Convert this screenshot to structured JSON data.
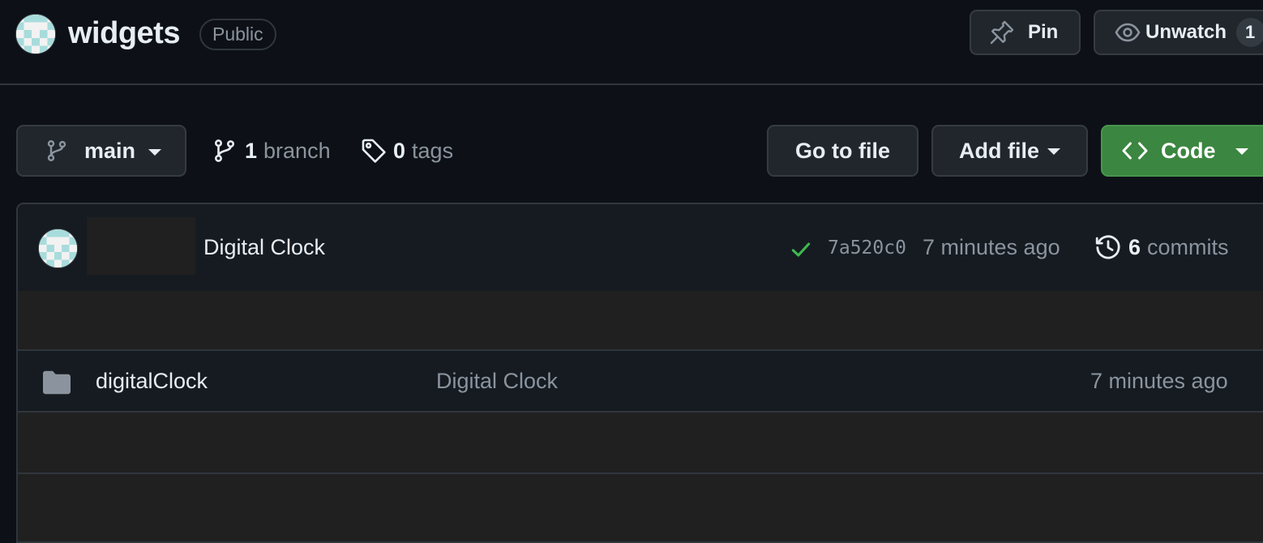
{
  "repo": {
    "name": "widgets",
    "visibility": "Public"
  },
  "header_actions": {
    "pin_label": "Pin",
    "watch_label": "Unwatch",
    "watch_count": "1"
  },
  "toolbar": {
    "branch": "main",
    "branch_count": "1",
    "branch_word": "branch",
    "tag_count": "0",
    "tag_word": "tags",
    "goto_file_label": "Go to file",
    "add_file_label": "Add file",
    "code_label": "Code"
  },
  "latest_commit": {
    "message": "Digital Clock",
    "status": "success",
    "sha": "7a520c0",
    "time": "7 minutes ago",
    "commit_count": "6",
    "commit_word": "commits"
  },
  "files": [
    {
      "type": "folder",
      "name": "digitalClock",
      "last_commit_message": "Digital Clock",
      "age": "7 minutes ago"
    }
  ],
  "icons": {
    "avatar": "identicon",
    "pin": "pin-icon",
    "watch": "eye-icon",
    "branch": "git-branch-icon",
    "tag": "tag-icon",
    "code": "code-icon",
    "check": "check-icon",
    "history": "history-icon",
    "folder": "folder-icon"
  },
  "colors": {
    "background": "#0d1117",
    "surface": "#161b22",
    "button": "#21262d",
    "border": "#30363d",
    "code_button": "#3b8640",
    "success": "#3fb950",
    "muted_text": "#8b949e",
    "text": "#e6edf3",
    "identicon": "#a8dcdc"
  }
}
